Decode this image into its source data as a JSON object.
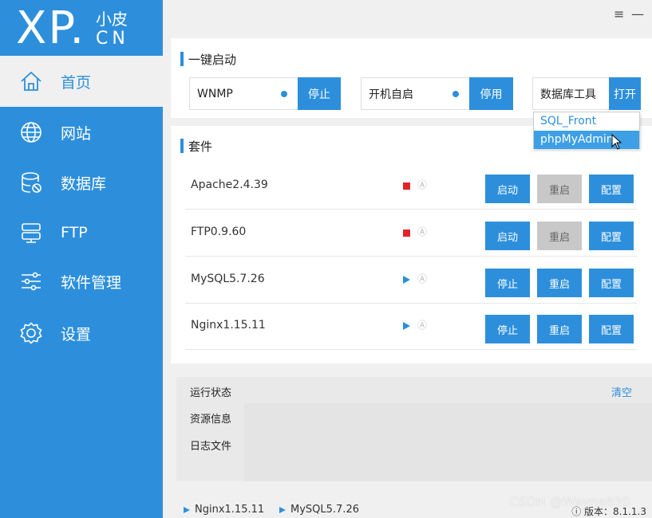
{
  "logo": {
    "main": "XP.",
    "cn_top": "小皮",
    "cn_bottom": "CN"
  },
  "window": {
    "menu_icon": "≡",
    "minimize_icon": "—"
  },
  "sidebar": {
    "items": [
      {
        "label": "首页",
        "icon": "home-icon",
        "active": true
      },
      {
        "label": "网站",
        "icon": "globe-icon",
        "active": false
      },
      {
        "label": "数据库",
        "icon": "database-icon",
        "active": false
      },
      {
        "label": "FTP",
        "icon": "ftp-icon",
        "active": false
      },
      {
        "label": "软件管理",
        "icon": "sliders-icon",
        "active": false
      },
      {
        "label": "设置",
        "icon": "gear-icon",
        "active": false
      }
    ]
  },
  "quick_start": {
    "title": "一键启动",
    "wnmp": {
      "label": "WNMP",
      "button": "停止"
    },
    "autostart": {
      "label": "开机自启",
      "button": "停用"
    },
    "db_tool": {
      "label": "数据库工具",
      "button": "打开"
    },
    "dropdown": [
      "SQL_Front",
      "phpMyAdmin"
    ]
  },
  "suite": {
    "title": "套件",
    "rows": [
      {
        "name": "Apache2.4.39",
        "state": "stopped",
        "auto": "Ⓐ",
        "btn1": "启动",
        "btn2": "重启",
        "btn3": "配置"
      },
      {
        "name": "FTP0.9.60",
        "state": "stopped",
        "auto": "Ⓐ",
        "btn1": "启动",
        "btn2": "重启",
        "btn3": "配置"
      },
      {
        "name": "MySQL5.7.26",
        "state": "running",
        "auto": "Ⓐ",
        "btn1": "停止",
        "btn2": "重启",
        "btn3": "配置"
      },
      {
        "name": "Nginx1.15.11",
        "state": "running",
        "auto": "Ⓐ",
        "btn1": "停止",
        "btn2": "重启",
        "btn3": "配置"
      }
    ]
  },
  "status": {
    "tabs": [
      "运行状态",
      "资源信息",
      "日志文件"
    ],
    "clear": "清空"
  },
  "footer": {
    "items": [
      "Nginx1.15.11",
      "MySQL5.7.26"
    ],
    "version": "ⓘ 版本：8.1.1.3",
    "watermark": "CSDN @Wayne830"
  },
  "colors": {
    "accent": "#2d8fdc",
    "stopped": "#e0242a",
    "disabled_button": "#c8c8c8"
  }
}
